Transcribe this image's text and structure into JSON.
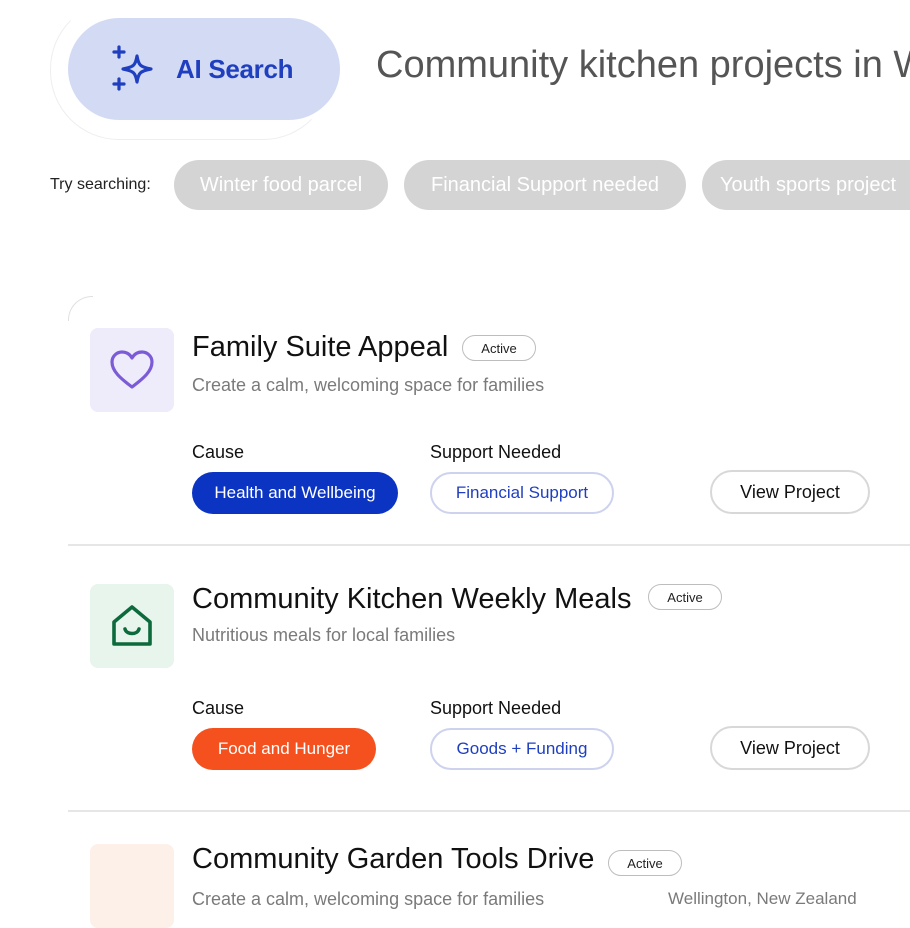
{
  "search": {
    "ai_button_label": "AI Search",
    "query_value": "Community kitchen projects in Wellington",
    "try_label": "Try searching:",
    "suggestions": [
      "Winter food parcel",
      "Financial Support needed",
      "Youth sports project"
    ]
  },
  "labels": {
    "cause": "Cause",
    "support_needed": "Support Needed",
    "view_project": "View Project"
  },
  "projects": [
    {
      "title": "Family Suite Appeal",
      "status": "Active",
      "description": "Create a calm, welcoming space for families",
      "cause": "Health and Wellbeing",
      "support": "Financial Support",
      "icon": "heart-icon",
      "icon_color": "#7b5bd6",
      "tile_color": "#eeebfb",
      "cause_color": "#0b34c2"
    },
    {
      "title": "Community Kitchen Weekly Meals",
      "status": "Active",
      "description": "Nutritious meals for local families",
      "cause": "Food and Hunger",
      "support": "Goods + Funding",
      "icon": "home-smile-icon",
      "icon_color": "#0c6a3c",
      "tile_color": "#e8f5ec",
      "cause_color": "#f4511e"
    },
    {
      "title": "Community Garden Tools Drive",
      "status": "Active",
      "description": "Create a calm, welcoming space for families",
      "location": "Wellington, New Zealand",
      "tile_color": "#fdf0e8"
    }
  ],
  "colors": {
    "ai_accent": "#1f3fbf",
    "ai_pill_bg": "#d3daf4",
    "chip_bg": "#d4d4d4"
  }
}
